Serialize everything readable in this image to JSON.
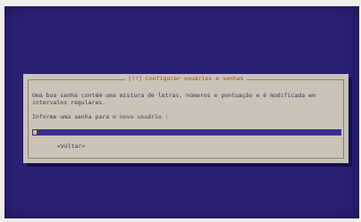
{
  "dialog": {
    "title": "[!!] Configurar usuários e senhas",
    "message": "Uma boa senha contém uma mistura de letras, números e pontuação e é modificada em intervalos regulares.",
    "prompt": "Informe uma senha para o novo usuário :",
    "password_value": "",
    "back_button_label": "<Voltar>"
  },
  "colors": {
    "screen_background": "#2a2177",
    "dialog_background": "#c9c3b8",
    "title_text": "#b23a2c",
    "input_field": "#3b2f8d",
    "cursor": "#d9c24a"
  }
}
